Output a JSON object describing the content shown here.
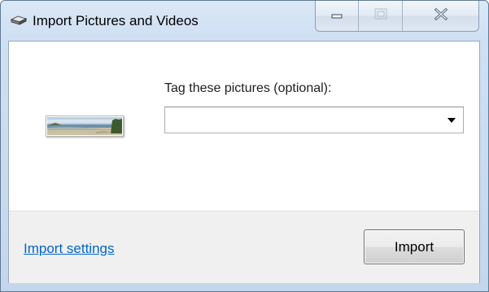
{
  "window": {
    "title": "Import Pictures and Videos",
    "title_icon": "camera-device-icon"
  },
  "caption_buttons": {
    "minimize_icon": "minimize-icon",
    "maximize_icon": "maximize-icon",
    "close_icon": "close-icon"
  },
  "content": {
    "tag_label": "Tag these pictures (optional):",
    "tag_value": "",
    "dropdown_icon": "dropdown-arrow-icon",
    "thumbnail": "panorama-beach-thumbnail"
  },
  "footer": {
    "import_settings_link": "Import settings",
    "import_button": "Import"
  },
  "colors": {
    "link": "#0066cc",
    "footer_background": "#f0f0f0",
    "frame": "#cfe0f3"
  }
}
